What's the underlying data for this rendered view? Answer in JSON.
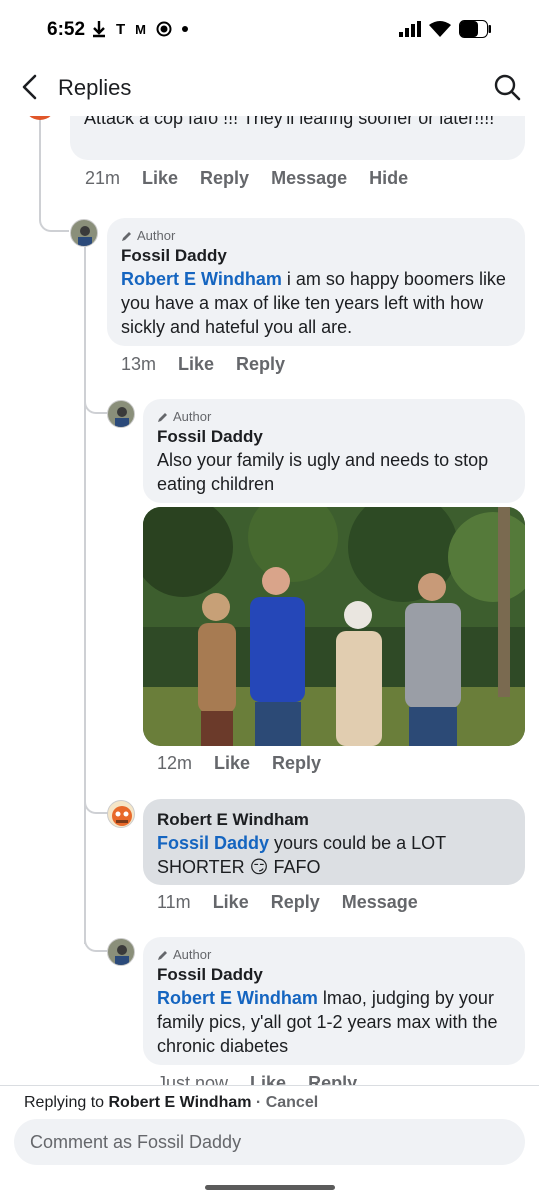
{
  "status_bar": {
    "time": "6:52",
    "left_icons": [
      "download-icon",
      "t-mobile-icon",
      "m-icon",
      "record-icon",
      "dot"
    ],
    "right_icons": [
      "signal-icon",
      "wifi-icon",
      "battery-icon"
    ]
  },
  "header": {
    "title": "Replies"
  },
  "comments": [
    {
      "text": "Attack a cop  fafo !!! They'll learing sooner or later!!!!",
      "time": "21m",
      "actions": [
        "Like",
        "Reply",
        "Message",
        "Hide"
      ]
    },
    {
      "author_tag": "Author",
      "name": "Fossil Daddy",
      "mention": "Robert E Windham",
      "text": " i am so happy boomers like you have a max of like ten years left with how sickly and hateful you all are.",
      "time": "13m",
      "actions": [
        "Like",
        "Reply"
      ]
    },
    {
      "author_tag": "Author",
      "name": "Fossil Daddy",
      "text": "Also your family is ugly and needs to stop eating children",
      "time": "12m",
      "actions": [
        "Like",
        "Reply"
      ]
    },
    {
      "name": "Robert E Windham",
      "mention": "Fossil Daddy",
      "text": " yours could be a LOT SHORTER 😏 FAFO",
      "time": "11m",
      "actions": [
        "Like",
        "Reply",
        "Message"
      ]
    },
    {
      "author_tag": "Author",
      "name": "Fossil Daddy",
      "mention": "Robert E Windham",
      "text": " lmao, judging by your family pics, y'all got 1-2 years max with the chronic diabetes",
      "time": "Just now",
      "actions": [
        "Like",
        "Reply"
      ]
    }
  ],
  "composer": {
    "replying_prefix": "Replying to",
    "replying_name": "Robert E Windham",
    "separator": "·",
    "cancel": "Cancel",
    "placeholder": "Comment as Fossil Daddy"
  }
}
